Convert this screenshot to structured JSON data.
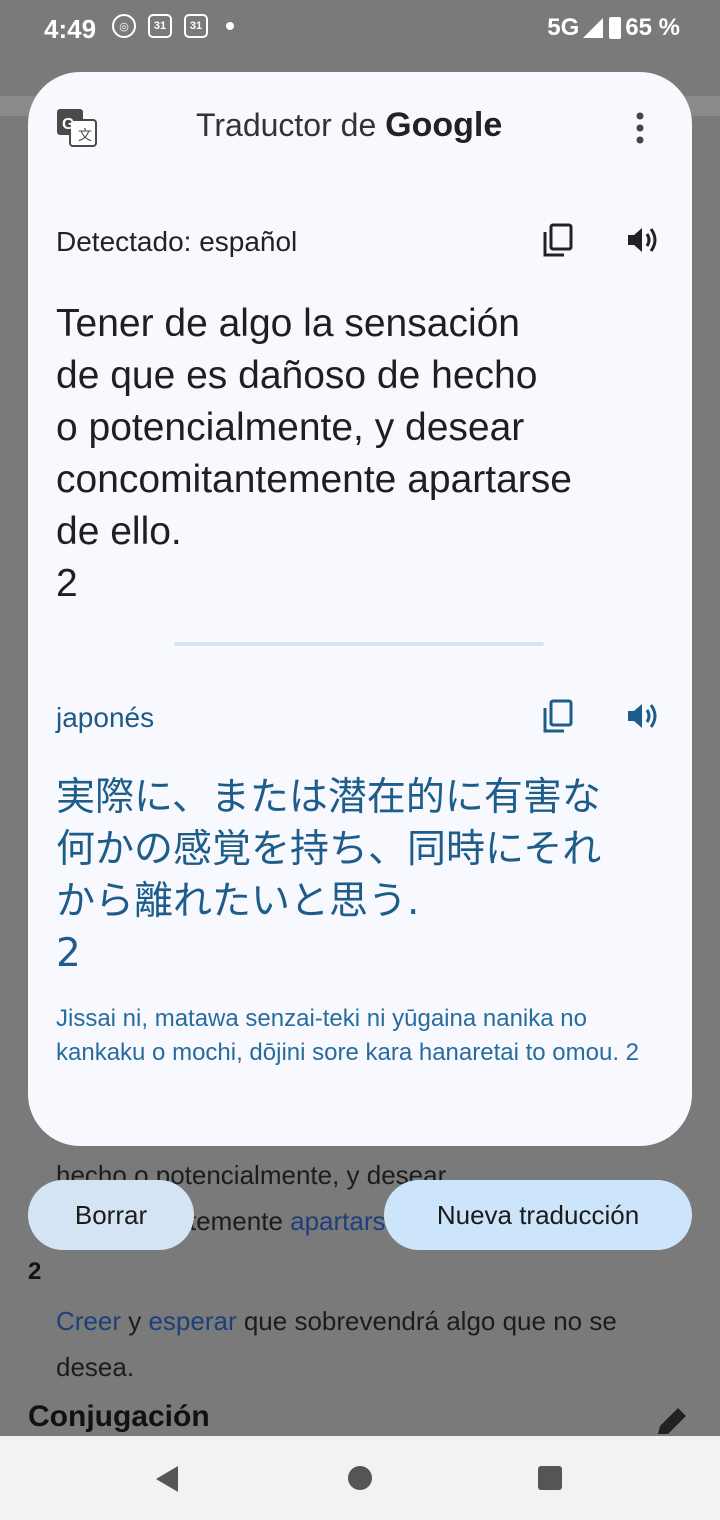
{
  "status_bar": {
    "time": "4:49",
    "network": "5G",
    "battery": "65 %",
    "notif_icons": [
      "cast-icon",
      "calendar-icon",
      "calendar-icon",
      "dot-icon"
    ],
    "calendar_day": "31"
  },
  "background": {
    "line1": "hecho o potencialmente, y desear",
    "line2_a": "concomitantemente ",
    "line2_link": "apartarse",
    "num": "2",
    "def_link1": "Creer",
    "def_y": " y ",
    "def_link2": "esperar",
    "def_rest": " que sobrevendrá algo que no se desea.",
    "heading": "Conjugación"
  },
  "buttons": {
    "clear": "Borrar",
    "new": "Nueva traducción"
  },
  "card": {
    "title_prefix": "Traductor de ",
    "title_brand": "Google",
    "source_lang": "Detectado: español",
    "source_text": "Tener de algo la sensación\nde que es dañoso de hecho\no potencialmente, y desear\nconcomitantemente apartarse\nde ello.\n2",
    "target_lang": "japonés",
    "target_text": "実際に、または潜在的に有害な\n何かの感覚を持ち、同時にそれ\nから離れたいと思う.\n 2",
    "romanization": "Jissai ni, matawa senzai-teki ni yūgaina nanika no kankaku o mochi, dōjini sore kara hanaretai to omou. 2"
  },
  "colors": {
    "accent": "#1e5d8a",
    "card_bg": "#f8f9fe",
    "scrim": "#7a7a7a",
    "button_bg": "#d4e4f4"
  },
  "nav": {
    "icons": [
      "back-icon",
      "home-icon",
      "recents-icon"
    ]
  }
}
